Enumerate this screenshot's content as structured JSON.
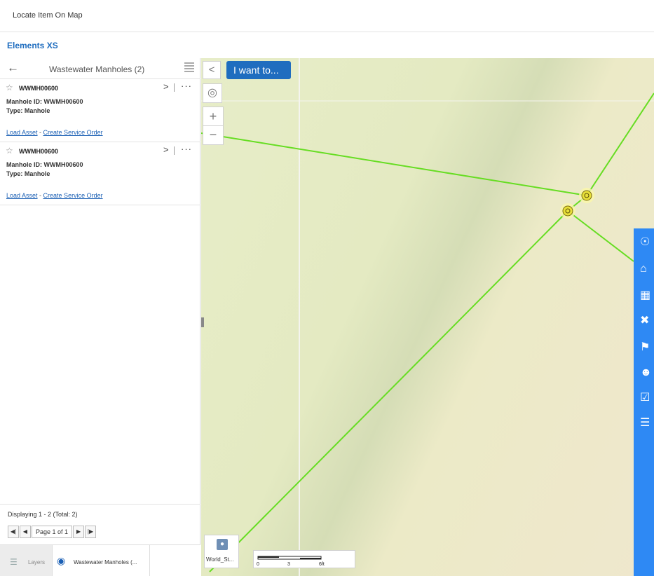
{
  "window": {
    "title": "Locate Item On Map"
  },
  "app": {
    "name": "Elements XS"
  },
  "panel": {
    "title": "Wastewater Manholes (2)",
    "results": [
      {
        "name": "WWMH00600",
        "id_line": "Manhole ID: WWMH00600",
        "type_line": "Type: Manhole",
        "link_load": "Load Asset",
        "link_sep": " - ",
        "link_service": "Create Service Order"
      },
      {
        "name": "WWMH00600",
        "id_line": "Manhole ID: WWMH00600",
        "type_line": "Type: Manhole",
        "link_load": "Load Asset",
        "link_sep": " - ",
        "link_service": "Create Service Order"
      }
    ],
    "footer": {
      "displaying": "Displaying 1 - 2 (Total: 2)",
      "page": "Page 1 of 1"
    },
    "tabs": {
      "layers": "Layers",
      "results": "Wastewater Manholes (..."
    }
  },
  "map": {
    "i_want_to": "I want to...",
    "basemap_label": "World_St...",
    "scale": {
      "tick0": "0",
      "tick1": "3",
      "tick2": "6ft"
    },
    "line_color": "#66dd22",
    "marker_color": "#e8e03a"
  },
  "toolbar": {
    "icons": [
      "xs-logo-icon",
      "home-icon",
      "building-icon",
      "cancel-icon",
      "map-pin-icon",
      "people-icon",
      "checkbox-icon",
      "list-icon"
    ]
  }
}
